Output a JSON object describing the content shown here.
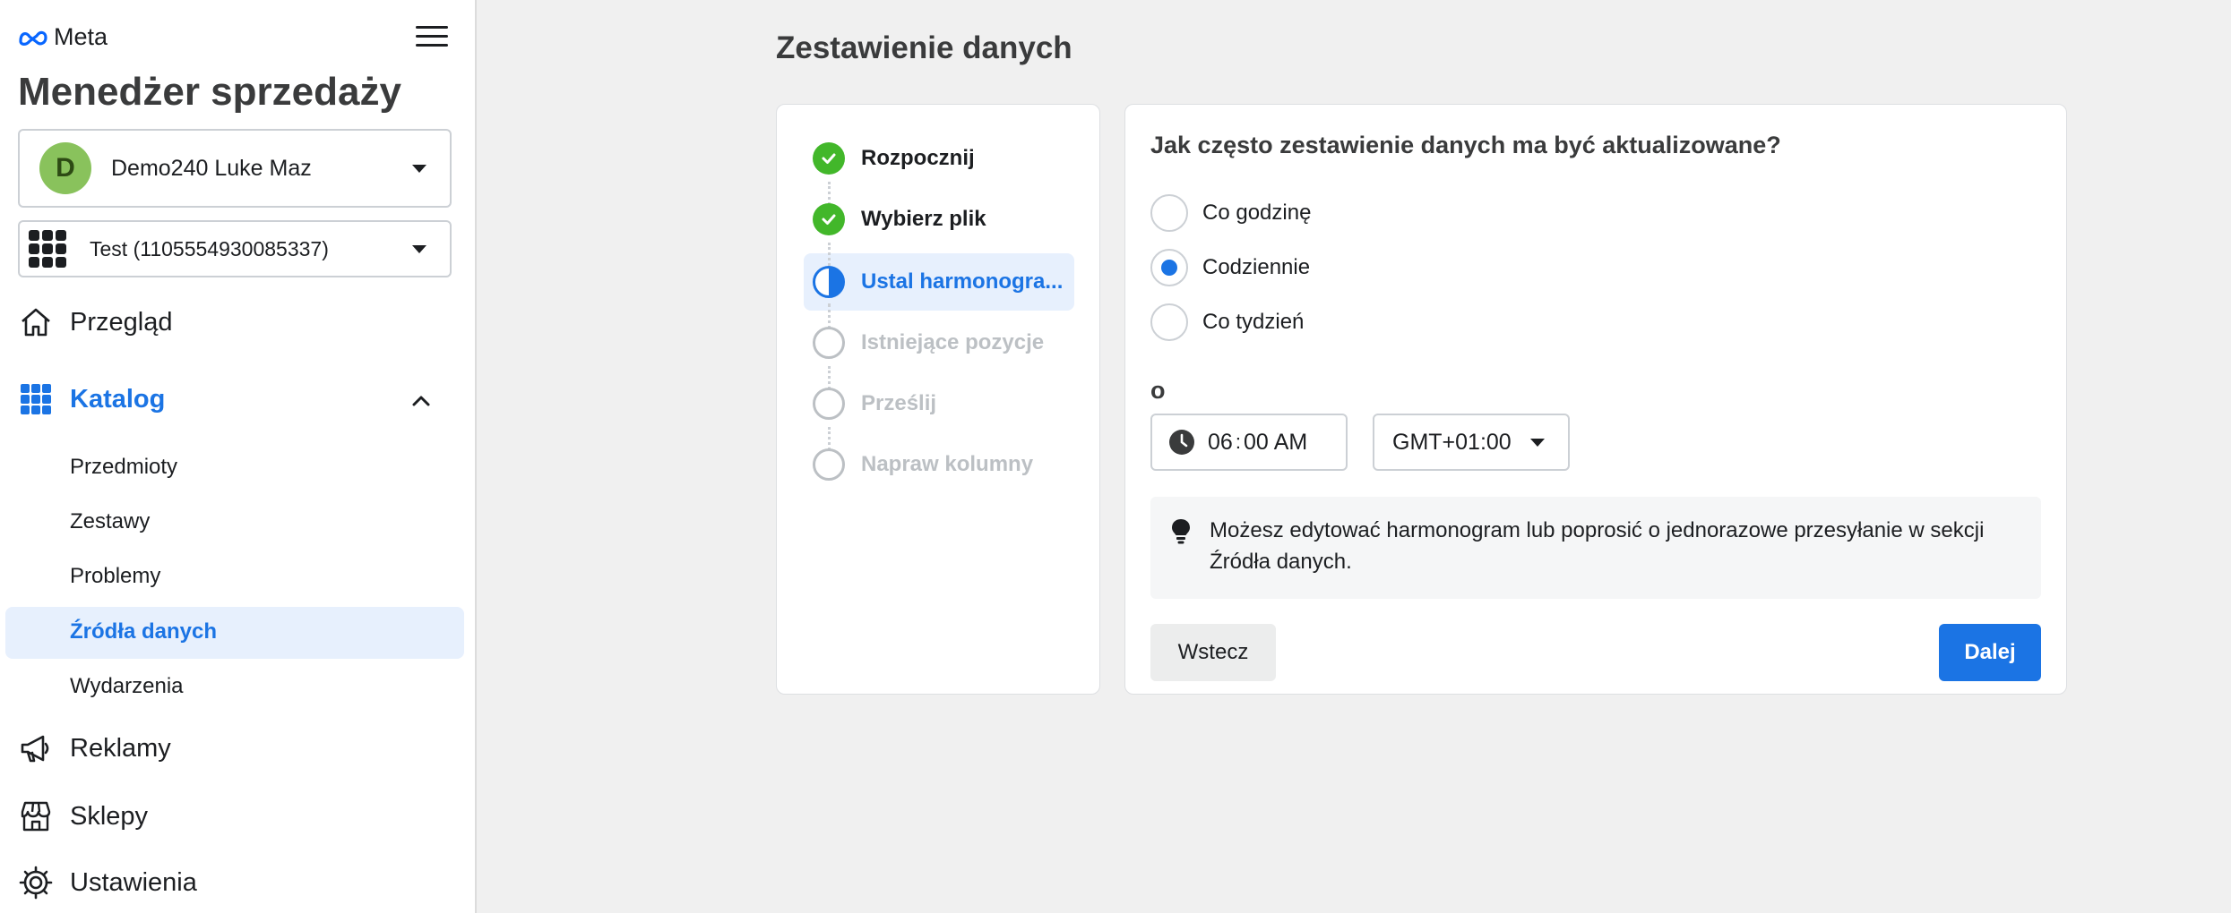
{
  "brand": {
    "logo_text": "Meta",
    "app_title": "Menedżer sprzedaży"
  },
  "account": {
    "initial": "D",
    "name": "Demo240 Luke Maz",
    "avatar_color": "#89c25c"
  },
  "catalog_select": {
    "name": "Test (1105554930085337)"
  },
  "nav": {
    "overview": "Przegląd",
    "catalog": "Katalog",
    "catalog_items": [
      "Przedmioty",
      "Zestawy",
      "Problemy",
      "Źródła danych",
      "Wydarzenia"
    ],
    "ads": "Reklamy",
    "shops": "Sklepy",
    "settings": "Ustawienia"
  },
  "page": {
    "title": "Zestawienie danych"
  },
  "steps": [
    {
      "label": "Rozpocznij",
      "state": "done"
    },
    {
      "label": "Wybierz plik",
      "state": "done"
    },
    {
      "label": "Ustal harmonogra...",
      "state": "current"
    },
    {
      "label": "Istniejące pozycje",
      "state": "todo"
    },
    {
      "label": "Prześlij",
      "state": "todo"
    },
    {
      "label": "Napraw kolumny",
      "state": "todo"
    }
  ],
  "form": {
    "question": "Jak często zestawienie danych ma być aktualizowane?",
    "options": [
      "Co godzinę",
      "Codziennie",
      "Co tydzień"
    ],
    "selected_option": "Codziennie",
    "at_label": "o",
    "time_hour": "06",
    "time_minute": "00",
    "time_ampm": "AM",
    "timezone": "GMT+01:00",
    "info_text": "Możesz edytować harmonogram lub poprosić o jednorazowe przesyłanie w sekcji Źródła danych.",
    "back_label": "Wstecz",
    "next_label": "Dalej"
  },
  "colors": {
    "accent": "#1b74e4",
    "success": "#42b72a",
    "active_bg": "#e7f0fd"
  }
}
